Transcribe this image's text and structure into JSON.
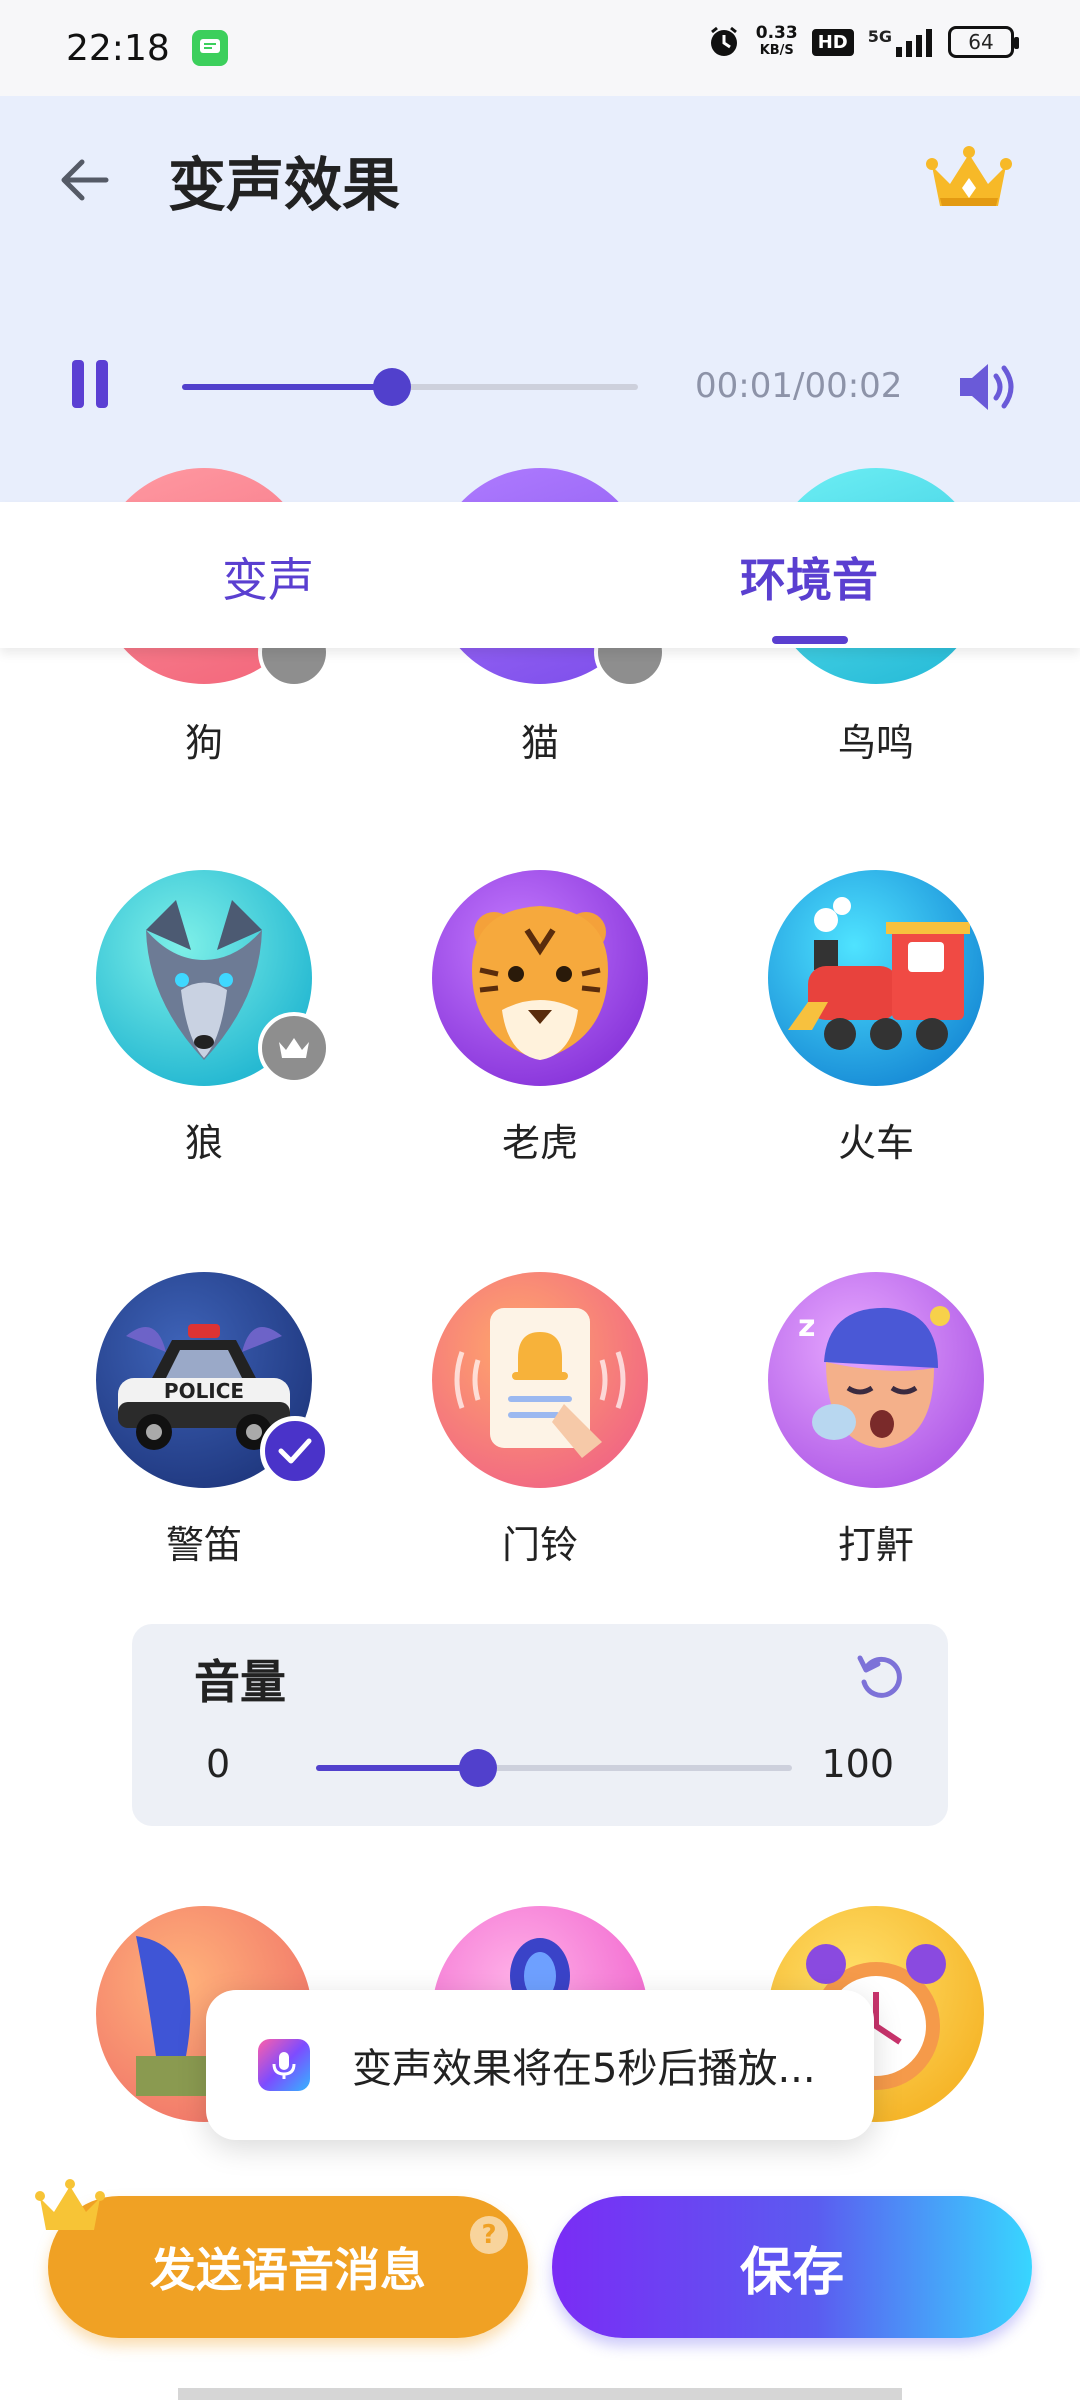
{
  "status_bar": {
    "time": "22:18",
    "speed_value": "0.33",
    "speed_unit": "KB/S",
    "hd": "HD",
    "network": "5G",
    "battery": "64"
  },
  "header": {
    "title": "变声效果",
    "icons": [
      "back-arrow-icon",
      "crown-icon"
    ]
  },
  "player": {
    "state": "playing",
    "progress": 0.46,
    "time_text": "00:01/00:02"
  },
  "tabs": [
    {
      "label": "变声",
      "active": false
    },
    {
      "label": "环境音",
      "active": true
    }
  ],
  "effects": [
    {
      "label": "狗",
      "vip": true,
      "selected": false
    },
    {
      "label": "猫",
      "vip": true,
      "selected": false
    },
    {
      "label": "鸟鸣",
      "vip": false,
      "selected": false
    },
    {
      "label": "狼",
      "vip": true,
      "selected": false
    },
    {
      "label": "老虎",
      "vip": false,
      "selected": false
    },
    {
      "label": "火车",
      "vip": false,
      "selected": false
    },
    {
      "label": "警笛",
      "vip": false,
      "selected": true
    },
    {
      "label": "门铃",
      "vip": false,
      "selected": false
    },
    {
      "label": "打鼾",
      "vip": false,
      "selected": false
    }
  ],
  "police_car_text": "POLICE",
  "volume": {
    "title": "音量",
    "min": "0",
    "max": "100",
    "value": 34
  },
  "toast": {
    "text": "变声效果将在5秒后播放..."
  },
  "buttons": {
    "send": "发送语音消息",
    "send_help": "?",
    "save": "保存"
  },
  "colors": {
    "accent": "#5140cc",
    "header_bg": "#e8eefc",
    "send": "#f0a124"
  }
}
